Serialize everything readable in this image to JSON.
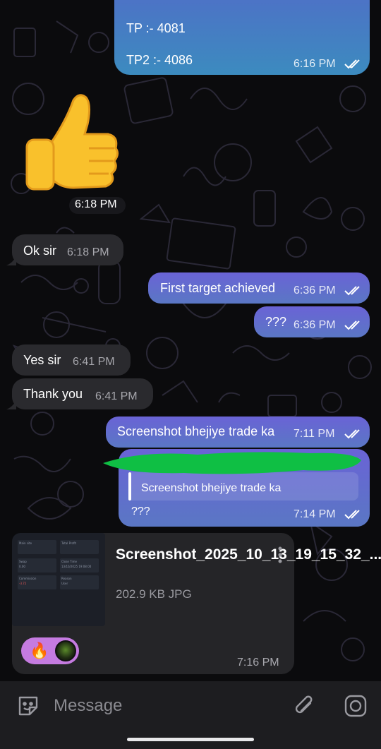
{
  "messages": {
    "tp": {
      "text": "TP :- 4081",
      "direction": "out"
    },
    "tp2": {
      "text": "TP2 :- 4086",
      "time": "6:16 PM",
      "direction": "out"
    },
    "sticker": {
      "emoji": "👍",
      "time": "6:18 PM",
      "direction": "in"
    },
    "ok_sir": {
      "text": "Ok sir",
      "time": "6:18 PM",
      "direction": "in"
    },
    "first_target": {
      "text": "First target achieved",
      "time": "6:36 PM",
      "direction": "out"
    },
    "question": {
      "text": "???",
      "time": "6:36 PM",
      "direction": "out"
    },
    "yes_sir": {
      "text": "Yes sir",
      "time": "6:41 PM",
      "direction": "in"
    },
    "thank_you": {
      "text": "Thank you",
      "time": "6:41 PM",
      "direction": "in"
    },
    "screenshot_req": {
      "text": "Screenshot bhejiye trade ka",
      "time": "7:11 PM",
      "direction": "out"
    },
    "reply": {
      "quoted_text": "Screenshot bhejiye trade ka",
      "text": "???",
      "time": "7:14 PM",
      "direction": "out"
    },
    "file": {
      "name": "Screenshot_2025_10_13_19_15_32_...",
      "meta": "202.9 KB JPG",
      "time": "7:16 PM",
      "direction": "in",
      "thumb_text": {
        "c1a": "Main site",
        "c1b": "Total Profit",
        "c2a": "Swap",
        "c2b": "Close Time",
        "c2c": "0.00",
        "c2d": "13/10/2025 19:08:00",
        "c3a": "Commission",
        "c3b": "Reason",
        "c3c": "-3.72",
        "c3d": "User"
      },
      "reactions": [
        "🔥",
        "avatar"
      ]
    }
  },
  "input": {
    "placeholder": "Message",
    "icons": [
      "sticker-emoji-icon",
      "attach-paperclip-icon",
      "camera-icon"
    ]
  },
  "colors": {
    "outgoing_top": "#6a63d6",
    "outgoing_bottom": "#5a77c4",
    "incoming": "#2a2a2e",
    "background": "#0b0b0d",
    "scribble": "#0fbf44",
    "reaction_pill": "#c57be0"
  }
}
